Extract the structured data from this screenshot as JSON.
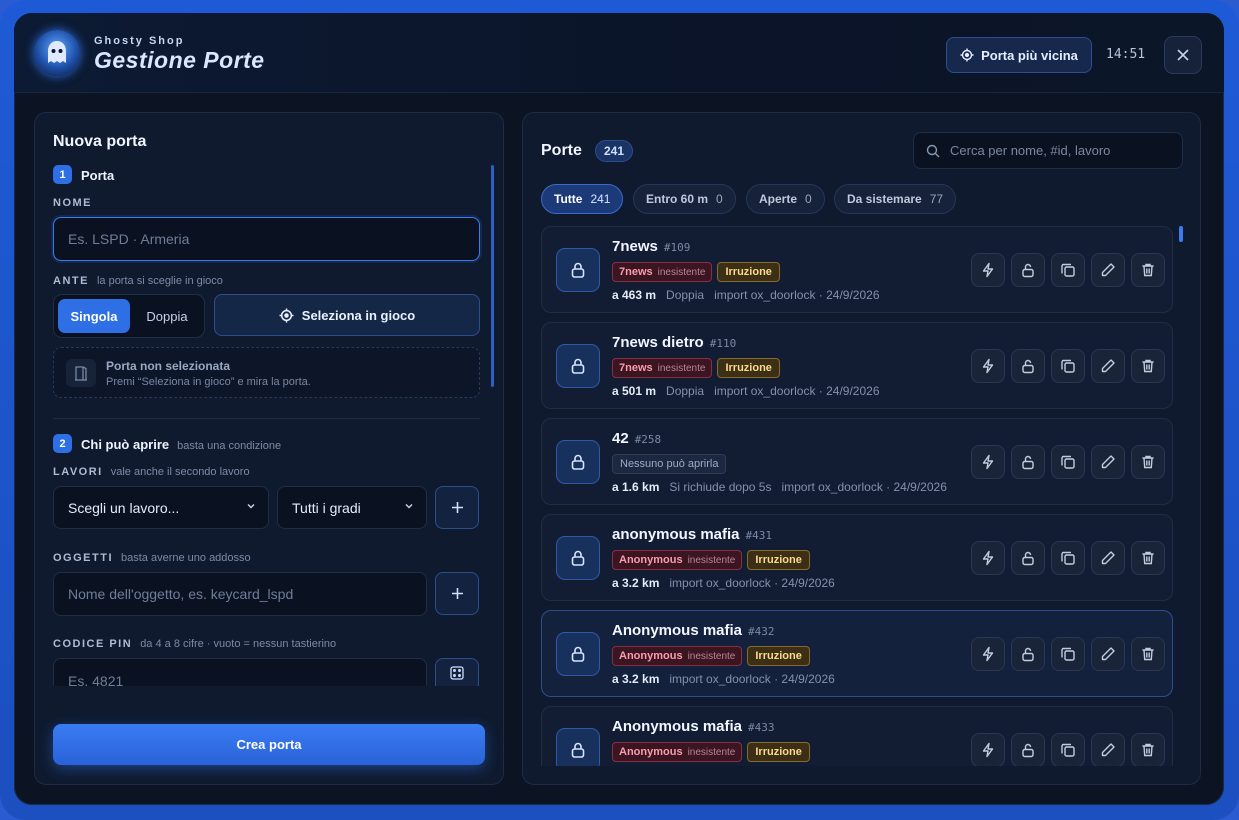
{
  "header": {
    "brand_small": "Ghosty Shop",
    "title": "Gestione Porte",
    "nearest_button": "Porta più vicina",
    "clock": "14:51"
  },
  "form": {
    "title": "Nuova porta",
    "step1": {
      "num": "1",
      "title": "Porta"
    },
    "name_label": "NOME",
    "name_placeholder": "Es. LSPD · Armeria",
    "leaves_label": "ANTE",
    "leaves_hint": "la porta si sceglie in gioco",
    "leaves_options": [
      "Singola",
      "Doppia"
    ],
    "leaves_selected": "Singola",
    "select_in_game": "Seleziona in gioco",
    "notice_title": "Porta non selezionata",
    "notice_sub": "Premi “Seleziona in gioco” e mira la porta.",
    "step2": {
      "num": "2",
      "title": "Chi può aprire",
      "hint": "basta una condizione"
    },
    "jobs_label": "LAVORI",
    "jobs_hint": "vale anche il secondo lavoro",
    "job_select": "Scegli un lavoro...",
    "grade_select": "Tutti i gradi",
    "items_label": "OGGETTI",
    "items_hint": "basta averne uno addosso",
    "items_placeholder": "Nome dell'oggetto, es. keycard_lspd",
    "pin_label": "CODICE PIN",
    "pin_hint": "da 4 a 8 cifre · vuoto = nessun tastierino",
    "pin_placeholder": "Es. 4821",
    "create_button": "Crea porta"
  },
  "list": {
    "title": "Porte",
    "count": "241",
    "search_placeholder": "Cerca per nome, #id, lavoro",
    "filters": [
      {
        "label": "Tutte",
        "count": "241",
        "active": true
      },
      {
        "label": "Entro 60 m",
        "count": "0",
        "active": false
      },
      {
        "label": "Aperte",
        "count": "0",
        "active": false
      },
      {
        "label": "Da sistemare",
        "count": "77",
        "active": false
      }
    ],
    "rows": [
      {
        "name": "7news",
        "id": "#109",
        "job": "7news",
        "job_state": "inesistente",
        "type": "Irruzione",
        "dist": "a 463 m",
        "meta": [
          "Doppia",
          "import ox_doorlock · 24/9/2026"
        ]
      },
      {
        "name": "7news dietro",
        "id": "#110",
        "job": "7news",
        "job_state": "inesistente",
        "type": "Irruzione",
        "dist": "a 501 m",
        "meta": [
          "Doppia",
          "import ox_doorlock · 24/9/2026"
        ]
      },
      {
        "name": "42",
        "id": "#258",
        "grey": "Nessuno può aprirla",
        "dist": "a 1.6 km",
        "meta": [
          "Si richiude dopo 5s",
          "import ox_doorlock · 24/9/2026"
        ]
      },
      {
        "name": "anonymous mafia",
        "id": "#431",
        "job": "Anonymous",
        "job_state": "inesistente",
        "type": "Irruzione",
        "dist": "a 3.2 km",
        "meta": [
          "import ox_doorlock · 24/9/2026"
        ]
      },
      {
        "name": "Anonymous mafia",
        "id": "#432",
        "job": "Anonymous",
        "job_state": "inesistente",
        "type": "Irruzione",
        "dist": "a 3.2 km",
        "meta": [
          "import ox_doorlock · 24/9/2026"
        ],
        "highlight": true
      },
      {
        "name": "Anonymous mafia",
        "id": "#433",
        "job": "Anonymous",
        "job_state": "inesistente",
        "type": "Irruzione",
        "dist": "",
        "meta": []
      }
    ]
  }
}
